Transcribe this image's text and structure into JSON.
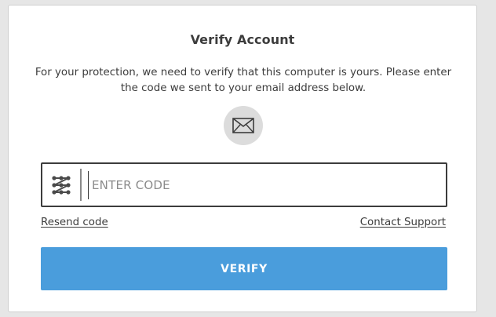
{
  "dialog": {
    "title": "Verify Account",
    "description": "For your protection, we need to verify that this computer is yours. Please enter the code we sent to your email address below.",
    "mail_icon": "envelope-icon",
    "code_icon": "keypad-icon"
  },
  "code_field": {
    "placeholder": "ENTER CODE",
    "value": ""
  },
  "links": {
    "resend": "Resend code",
    "support": "Contact Support"
  },
  "verify_button": {
    "label": "VERIFY",
    "color": "#4a9ddc"
  }
}
